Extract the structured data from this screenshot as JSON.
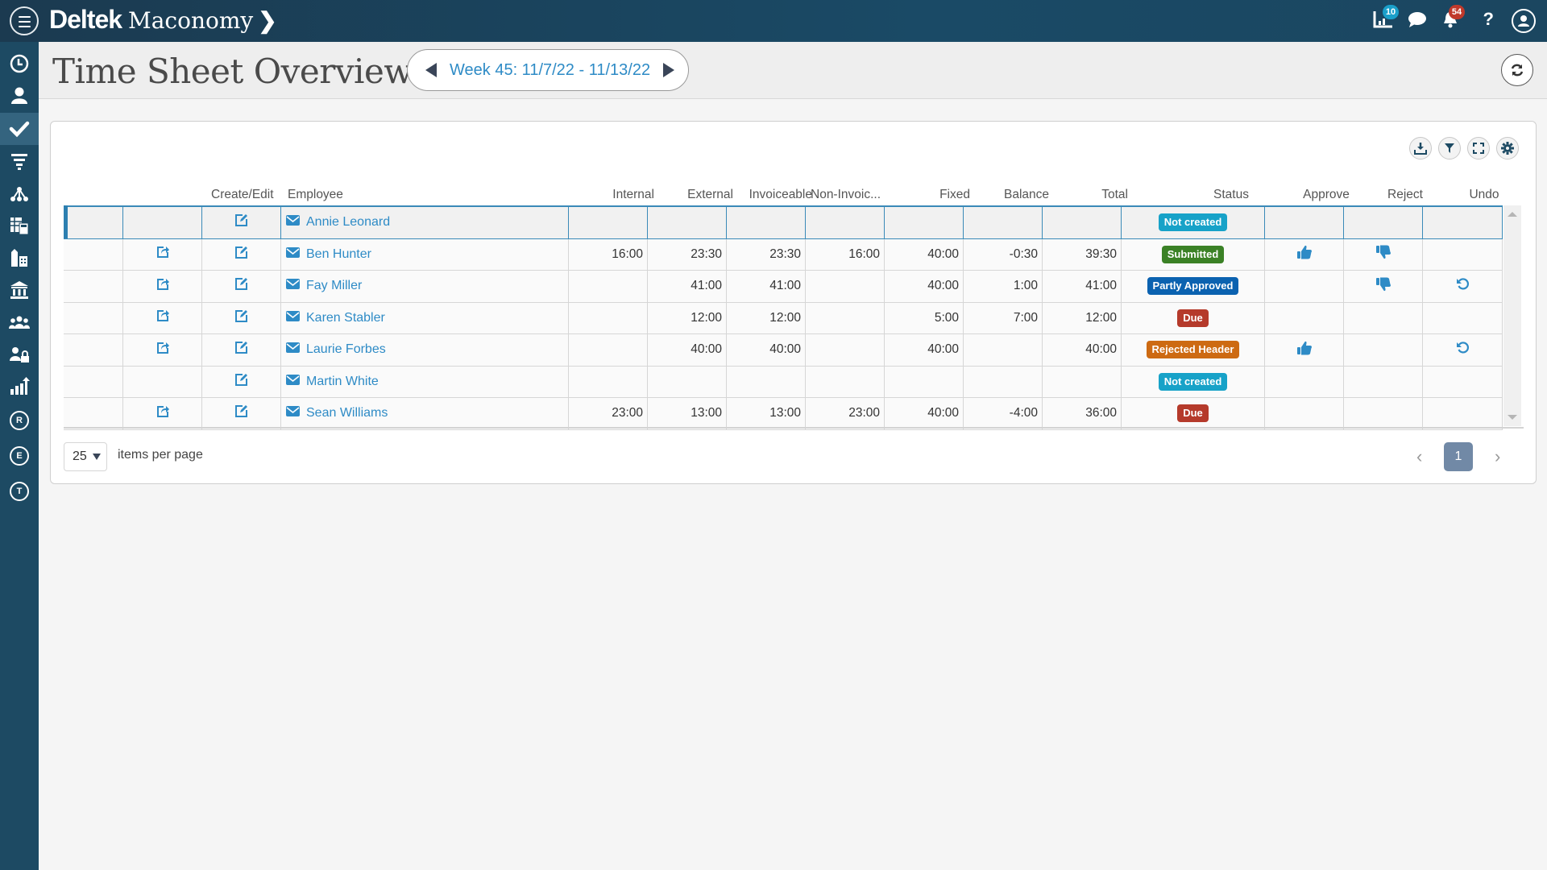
{
  "app": {
    "brand_primary": "Deltek",
    "brand_secondary": "Maconomy",
    "brand_chevron": "❯"
  },
  "header_icons": [
    {
      "name": "analytics-icon",
      "badge": "10",
      "badge_color": "#1a9fc9"
    },
    {
      "name": "chat-icon",
      "badge": null
    },
    {
      "name": "notifications-bell-icon",
      "badge": "54",
      "badge_color": "#c0392b"
    },
    {
      "name": "help-icon",
      "glyph": "?"
    },
    {
      "name": "user-profile-icon"
    }
  ],
  "sidebar": {
    "items": [
      {
        "name": "time",
        "icon": "clock-icon"
      },
      {
        "name": "person",
        "icon": "person-icon"
      },
      {
        "name": "approvals",
        "icon": "checkmark-icon",
        "active": true
      },
      {
        "name": "filter",
        "icon": "funnel-icon"
      },
      {
        "name": "hierarchy",
        "icon": "org-tree-icon"
      },
      {
        "name": "calculator",
        "icon": "spreadsheet-calculator-icon"
      },
      {
        "name": "buildings",
        "icon": "buildings-icon"
      },
      {
        "name": "bank",
        "icon": "bank-icon"
      },
      {
        "name": "team",
        "icon": "group-icon"
      },
      {
        "name": "user-lock",
        "icon": "user-lock-icon"
      },
      {
        "name": "reports",
        "icon": "bar-chart-up-icon"
      },
      {
        "name": "r",
        "letter": "R"
      },
      {
        "name": "e",
        "letter": "E"
      },
      {
        "name": "t",
        "letter": "T"
      }
    ]
  },
  "page": {
    "title": "Time Sheet Overview",
    "week_label": "Week 45: 11/7/22 - 11/13/22"
  },
  "table": {
    "columns": {
      "create_edit": "Create/Edit",
      "employee": "Employee",
      "internal": "Internal",
      "external": "External",
      "invoiceable": "Invoiceable",
      "non_invoiceable": "Non-Invoic...",
      "fixed": "Fixed",
      "balance": "Balance",
      "total": "Total",
      "status": "Status",
      "approve": "Approve",
      "reject": "Reject",
      "undo": "Undo"
    },
    "rows": [
      {
        "employee": "Annie Leonard",
        "open": false,
        "internal": "",
        "external": "",
        "invoiceable": "",
        "non_invoiceable": "",
        "fixed": "",
        "balance": "",
        "total": "",
        "status": "Not created",
        "status_color": "#17a2c8",
        "approve": false,
        "reject": false,
        "undo": false,
        "selected": true
      },
      {
        "employee": "Ben Hunter",
        "open": true,
        "internal": "16:00",
        "external": "23:30",
        "invoiceable": "23:30",
        "non_invoiceable": "16:00",
        "fixed": "40:00",
        "balance": "-0:30",
        "total": "39:30",
        "status": "Submitted",
        "status_color": "#3b8126",
        "approve": true,
        "reject": true,
        "undo": false
      },
      {
        "employee": "Fay Miller",
        "open": true,
        "internal": "",
        "external": "41:00",
        "invoiceable": "41:00",
        "non_invoiceable": "",
        "fixed": "40:00",
        "balance": "1:00",
        "total": "41:00",
        "status": "Partly Approved",
        "status_color": "#0b62b0",
        "approve": false,
        "reject": true,
        "undo": true
      },
      {
        "employee": "Karen Stabler",
        "open": true,
        "internal": "",
        "external": "12:00",
        "invoiceable": "12:00",
        "non_invoiceable": "",
        "fixed": "5:00",
        "balance": "7:00",
        "total": "12:00",
        "status": "Due",
        "status_color": "#b53a2b",
        "approve": false,
        "reject": false,
        "undo": false
      },
      {
        "employee": "Laurie Forbes",
        "open": true,
        "internal": "",
        "external": "40:00",
        "invoiceable": "40:00",
        "non_invoiceable": "",
        "fixed": "40:00",
        "balance": "",
        "total": "40:00",
        "status": "Rejected Header",
        "status_color": "#cd6a12",
        "approve": true,
        "reject": false,
        "undo": true
      },
      {
        "employee": "Martin White",
        "open": false,
        "internal": "",
        "external": "",
        "invoiceable": "",
        "non_invoiceable": "",
        "fixed": "",
        "balance": "",
        "total": "",
        "status": "Not created",
        "status_color": "#17a2c8",
        "approve": false,
        "reject": false,
        "undo": false
      },
      {
        "employee": "Sean Williams",
        "open": true,
        "internal": "23:00",
        "external": "13:00",
        "invoiceable": "13:00",
        "non_invoiceable": "23:00",
        "fixed": "40:00",
        "balance": "-4:00",
        "total": "36:00",
        "status": "Due",
        "status_color": "#b53a2b",
        "approve": false,
        "reject": false,
        "undo": false
      }
    ]
  },
  "toolbar": {
    "buttons": [
      "export-download",
      "filter",
      "fullscreen",
      "settings"
    ]
  },
  "pagination": {
    "per_page": "25",
    "per_page_label": "items per page",
    "current_page": "1",
    "prev": "‹",
    "next": "›"
  },
  "colors": {
    "accent": "#2e8bc6",
    "header_bg": "#1b3a50",
    "sidebar_bg": "#1d4a63"
  }
}
